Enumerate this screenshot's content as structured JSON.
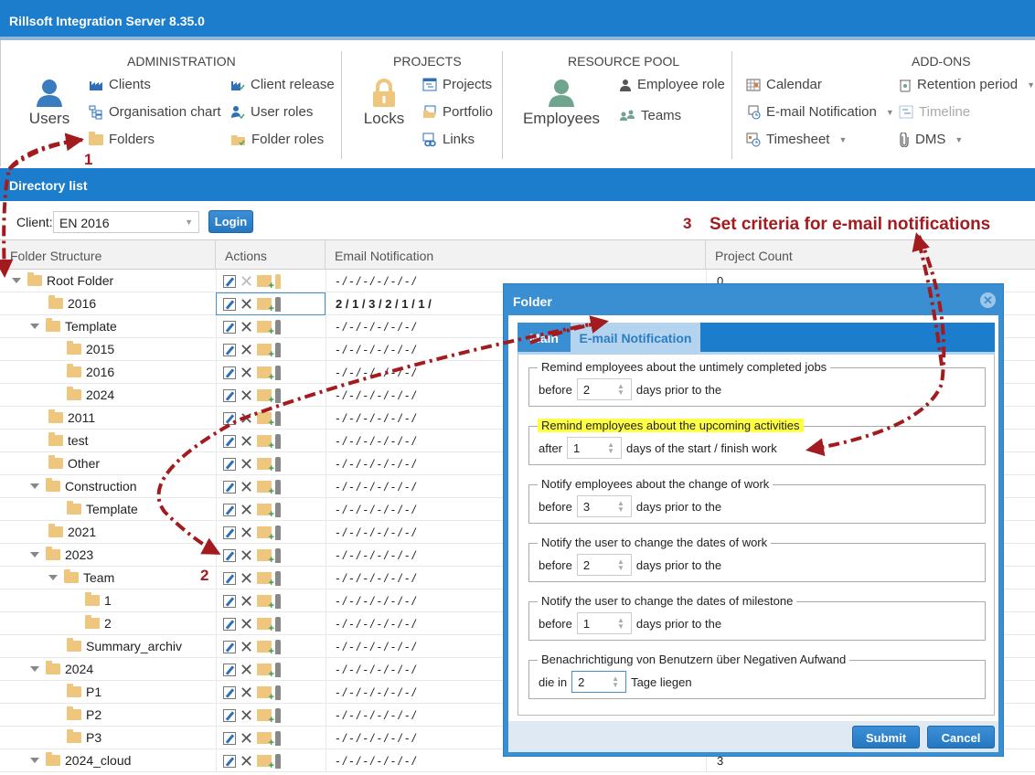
{
  "app": {
    "title": "Rillsoft Integration Server 8.35.0"
  },
  "ribbon": {
    "administration": {
      "title": "ADMINISTRATION",
      "big": {
        "label": "Users",
        "icon": "user-icon"
      },
      "items": [
        {
          "label": "Clients",
          "icon": "factory-icon"
        },
        {
          "label": "Organisation chart",
          "icon": "org-chart-icon"
        },
        {
          "label": "Folders",
          "icon": "folder-icon"
        },
        {
          "label": "Client release",
          "icon": "factory-check-icon"
        },
        {
          "label": "User roles",
          "icon": "user-check-icon"
        },
        {
          "label": "Folder roles",
          "icon": "folder-check-icon"
        }
      ]
    },
    "projects": {
      "title": "PROJECTS",
      "big": {
        "label": "Locks",
        "icon": "lock-icon"
      },
      "items": [
        {
          "label": "Projects",
          "icon": "gantt-icon"
        },
        {
          "label": "Portfolio",
          "icon": "portfolio-icon"
        },
        {
          "label": "Links",
          "icon": "link-icon"
        }
      ]
    },
    "resource_pool": {
      "title": "RESOURCE POOL",
      "big": {
        "label": "Employees",
        "icon": "employee-icon"
      },
      "items": [
        {
          "label": "Employee role",
          "icon": "employee-role-icon"
        },
        {
          "label": "Teams",
          "icon": "teams-icon"
        }
      ]
    },
    "addons": {
      "title": "ADD-ONS",
      "items": [
        {
          "label": "Calendar",
          "icon": "calendar-icon",
          "dropdown": false
        },
        {
          "label": "E-mail Notification",
          "icon": "email-clock-icon",
          "dropdown": true
        },
        {
          "label": "Timesheet",
          "icon": "timesheet-icon",
          "dropdown": true
        },
        {
          "label": "Retention period",
          "icon": "trash-icon",
          "dropdown": true
        },
        {
          "label": "Timeline",
          "icon": "timeline-icon",
          "dropdown": false,
          "disabled": true
        },
        {
          "label": "DMS",
          "icon": "paperclip-icon",
          "dropdown": true
        }
      ]
    }
  },
  "directory": {
    "title": "Directory list",
    "client_label": "Client:",
    "client_value": "EN 2016",
    "login_label": "Login",
    "columns": [
      "Folder Structure",
      "Actions",
      "Email Notification",
      "Project Count"
    ],
    "rows": [
      {
        "name": "Root Folder",
        "level": 0,
        "expanded": true,
        "mail": "- / - / - / - / - / - /",
        "count": "0",
        "root": true
      },
      {
        "name": "2016",
        "level": 1,
        "expanded": false,
        "mail": "2 / 1 / 3 / 2 / 1 / 1 /",
        "count": "",
        "selected": true
      },
      {
        "name": "Template",
        "level": 1,
        "expanded": true,
        "mail": "- / - / - / - / - / - /",
        "count": ""
      },
      {
        "name": "2015",
        "level": 2,
        "expanded": false,
        "mail": "- / - / - / - / - / - /",
        "count": ""
      },
      {
        "name": "2016",
        "level": 2,
        "expanded": false,
        "mail": "- / - / - / - / - / - /",
        "count": ""
      },
      {
        "name": "2024",
        "level": 2,
        "expanded": false,
        "mail": "- / - / - / - / - / - /",
        "count": ""
      },
      {
        "name": "2011",
        "level": 1,
        "expanded": false,
        "mail": "- / - / - / - / - / - /",
        "count": ""
      },
      {
        "name": "test",
        "level": 1,
        "expanded": false,
        "mail": "- / - / - / - / - / - /",
        "count": ""
      },
      {
        "name": "Other",
        "level": 1,
        "expanded": false,
        "mail": "- / - / - / - / - / - /",
        "count": ""
      },
      {
        "name": "Construction",
        "level": 1,
        "expanded": true,
        "mail": "- / - / - / - / - / - /",
        "count": ""
      },
      {
        "name": "Template",
        "level": 2,
        "expanded": false,
        "mail": "- / - / - / - / - / - /",
        "count": ""
      },
      {
        "name": "2021",
        "level": 1,
        "expanded": false,
        "mail": "- / - / - / - / - / - /",
        "count": ""
      },
      {
        "name": "2023",
        "level": 1,
        "expanded": true,
        "mail": "- / - / - / - / - / - /",
        "count": ""
      },
      {
        "name": "Team",
        "level": 2,
        "expanded": true,
        "mail": "- / - / - / - / - / - /",
        "count": ""
      },
      {
        "name": "1",
        "level": 3,
        "expanded": false,
        "mail": "- / - / - / - / - / - /",
        "count": ""
      },
      {
        "name": "2",
        "level": 3,
        "expanded": false,
        "mail": "- / - / - / - / - / - /",
        "count": ""
      },
      {
        "name": "Summary_archiv",
        "level": 2,
        "expanded": false,
        "mail": "- / - / - / - / - / - /",
        "count": ""
      },
      {
        "name": "2024",
        "level": 1,
        "expanded": true,
        "mail": "- / - / - / - / - / - /",
        "count": ""
      },
      {
        "name": "P1",
        "level": 2,
        "expanded": false,
        "mail": "- / - / - / - / - / - /",
        "count": ""
      },
      {
        "name": "P2",
        "level": 2,
        "expanded": false,
        "mail": "- / - / - / - / - / - /",
        "count": ""
      },
      {
        "name": "P3",
        "level": 2,
        "expanded": false,
        "mail": "- / - / - / - / - / - /",
        "count": ""
      },
      {
        "name": "2024_cloud",
        "level": 1,
        "expanded": true,
        "mail": "- / - / - / - / - / - /",
        "count": "3"
      }
    ]
  },
  "dialog": {
    "title": "Folder",
    "tabs": [
      "Main",
      "E-mail Notification"
    ],
    "active_tab": "E-mail Notification",
    "sections": [
      {
        "legend": "Remind employees about the untimely completed jobs",
        "prefix": "before",
        "value": "2",
        "suffix": "days prior to the"
      },
      {
        "legend": "Remind employees about the upcoming activities",
        "prefix": "after",
        "value": "1",
        "suffix": "days of the start / finish work",
        "highlighted": true
      },
      {
        "legend": "Notify employees about the change of work",
        "prefix": "before",
        "value": "3",
        "suffix": "days prior to the"
      },
      {
        "legend": "Notify the user to change the dates of work",
        "prefix": "before",
        "value": "2",
        "suffix": "days prior to the"
      },
      {
        "legend": "Notify the user to change the dates of milestone",
        "prefix": "before",
        "value": "1",
        "suffix": "days prior to the"
      },
      {
        "legend": "Benachrichtigung von Benutzern über Negativen Aufwand",
        "prefix": "die in",
        "value": "2",
        "suffix": "Tage liegen",
        "focused": true
      }
    ],
    "submit_label": "Submit",
    "cancel_label": "Cancel"
  },
  "annotations": {
    "step1": "1",
    "step2": "2",
    "step3": "3",
    "step3_text": "Set criteria for e-mail notifications",
    "color": "#a31b1f"
  }
}
